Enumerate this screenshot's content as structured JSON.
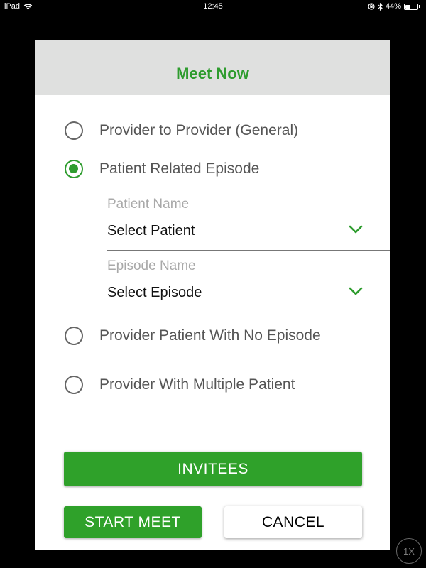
{
  "status_bar": {
    "device": "iPad",
    "time": "12:45",
    "battery_percent": "44%",
    "battery_level": 0.44,
    "icons": [
      "wifi-icon",
      "orientation-lock-icon",
      "bluetooth-icon",
      "battery-icon"
    ]
  },
  "dialog": {
    "title": "Meet Now",
    "options": [
      {
        "label": "Provider to Provider (General)",
        "checked": false
      },
      {
        "label": "Patient Related Episode",
        "checked": true
      },
      {
        "label": "Provider Patient With No Episode",
        "checked": false
      },
      {
        "label": "Provider With Multiple Patient",
        "checked": false
      }
    ],
    "patient_field": {
      "label": "Patient Name",
      "value": "Select Patient"
    },
    "episode_field": {
      "label": "Episode Name",
      "value": "Select Episode"
    },
    "buttons": {
      "invitees": "INVITEES",
      "start_meet": "START MEET",
      "cancel": "CANCEL"
    }
  },
  "zoom_badge": "1X",
  "colors": {
    "accent_green": "#2e9c2e",
    "button_green": "#2fa12a",
    "header_gray": "#dfe0df",
    "background": "#000000"
  }
}
